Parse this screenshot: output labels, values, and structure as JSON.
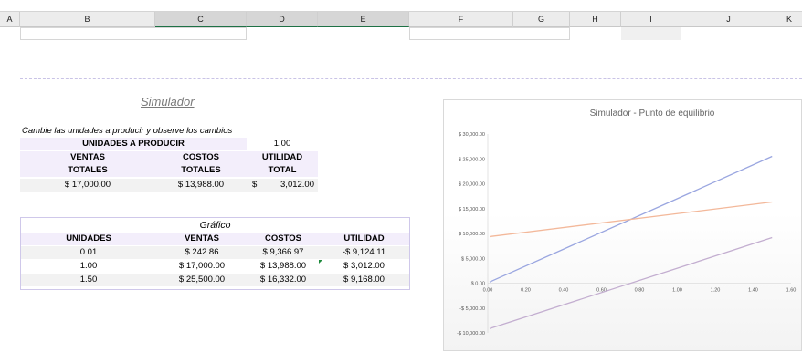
{
  "columns": [
    "A",
    "B",
    "C",
    "D",
    "E",
    "F",
    "G",
    "H",
    "I",
    "J",
    "K"
  ],
  "simulator": {
    "title": "Simulador",
    "instruction": "Cambie las unidades a producir y observe los cambios",
    "units_label": "UNIDADES A PRODUCIR",
    "units_value": "1.00",
    "headers": [
      [
        "VENTAS",
        "TOTALES"
      ],
      [
        "COSTOS",
        "TOTALES"
      ],
      [
        "UTILIDAD",
        "TOTAL"
      ]
    ],
    "values": {
      "sales": "$ 17,000.00",
      "costs": "$ 13,988.00",
      "profit_symbol": "$",
      "profit": "3,012.00"
    }
  },
  "table": {
    "title": "Gráfico",
    "headers": [
      "UNIDADES",
      "VENTAS",
      "COSTOS",
      "UTILIDAD"
    ],
    "rows": [
      [
        "0.01",
        "$ 242.86",
        "$ 9,366.97",
        "-$ 9,124.11"
      ],
      [
        "1.00",
        "$ 17,000.00",
        "$ 13,988.00",
        "$ 3,012.00"
      ],
      [
        "1.50",
        "$ 25,500.00",
        "$ 16,332.00",
        "$ 9,168.00"
      ]
    ]
  },
  "chart_data": {
    "type": "line",
    "title": "Simulador - Punto de equilibrio",
    "x": [
      0.01,
      1.0,
      1.5
    ],
    "xlim": [
      0,
      1.6
    ],
    "ylim": [
      -10000,
      30000
    ],
    "x_ticks": [
      "0.00",
      "0.20",
      "0.40",
      "0.60",
      "0.80",
      "1.00",
      "1.20",
      "1.40",
      "1.60"
    ],
    "y_ticks": [
      "$ 30,000.00",
      "$ 25,000.00",
      "$ 20,000.00",
      "$ 15,000.00",
      "$ 10,000.00",
      "$ 5,000.00",
      "$ 0.00",
      "-$ 5,000.00",
      "-$ 10,000.00"
    ],
    "series": [
      {
        "values": [
          242.86,
          17000,
          25500
        ],
        "color": "#9aa6e0"
      },
      {
        "values": [
          9366.97,
          13988,
          16332
        ],
        "color": "#f3b89a"
      },
      {
        "values": [
          -9124.11,
          3012,
          9168
        ],
        "color": "#c3aed0"
      }
    ]
  }
}
